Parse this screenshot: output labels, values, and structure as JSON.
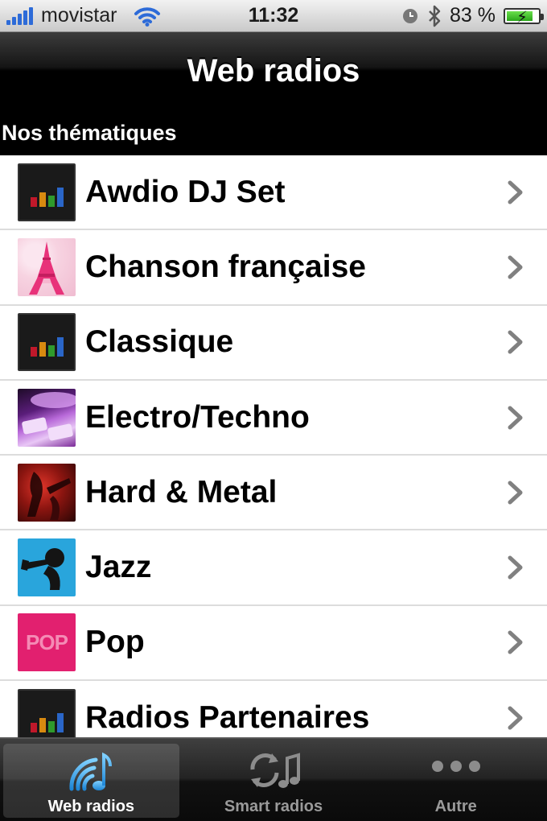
{
  "status_bar": {
    "carrier": "movistar",
    "time": "11:32",
    "battery_text": "83 %",
    "battery_level": 0.83
  },
  "nav_bar": {
    "title": "Web radios"
  },
  "section": {
    "title": "Nos thématiques"
  },
  "list": {
    "items": [
      {
        "label": "Awdio DJ Set",
        "thumbnail": "equalizer-icon"
      },
      {
        "label": "Chanson française",
        "thumbnail": "eiffel-tower-image"
      },
      {
        "label": "Classique",
        "thumbnail": "equalizer-icon"
      },
      {
        "label": "Electro/Techno",
        "thumbnail": "turntable-image"
      },
      {
        "label": "Hard & Metal",
        "thumbnail": "guitarist-image"
      },
      {
        "label": "Jazz",
        "thumbnail": "trumpet-player-image"
      },
      {
        "label": "Pop",
        "thumbnail": "pop-text-image",
        "thumbnail_text": "POP"
      },
      {
        "label": "Radios Partenaires",
        "thumbnail": "equalizer-icon"
      }
    ]
  },
  "tab_bar": {
    "tabs": [
      {
        "label": "Web radios",
        "icon": "radio-waves-note-icon",
        "active": true
      },
      {
        "label": "Smart radios",
        "icon": "refresh-note-icon",
        "active": false
      },
      {
        "label": "Autre",
        "icon": "more-dots-icon",
        "active": false
      }
    ]
  },
  "colors": {
    "signal": "#2d6bd8",
    "battery": "#2aa61a",
    "eq_bars": [
      "#c0182a",
      "#d88a10",
      "#2f9a2c",
      "#2a66c8"
    ],
    "active_tab_icon": "#2c9fe0"
  }
}
